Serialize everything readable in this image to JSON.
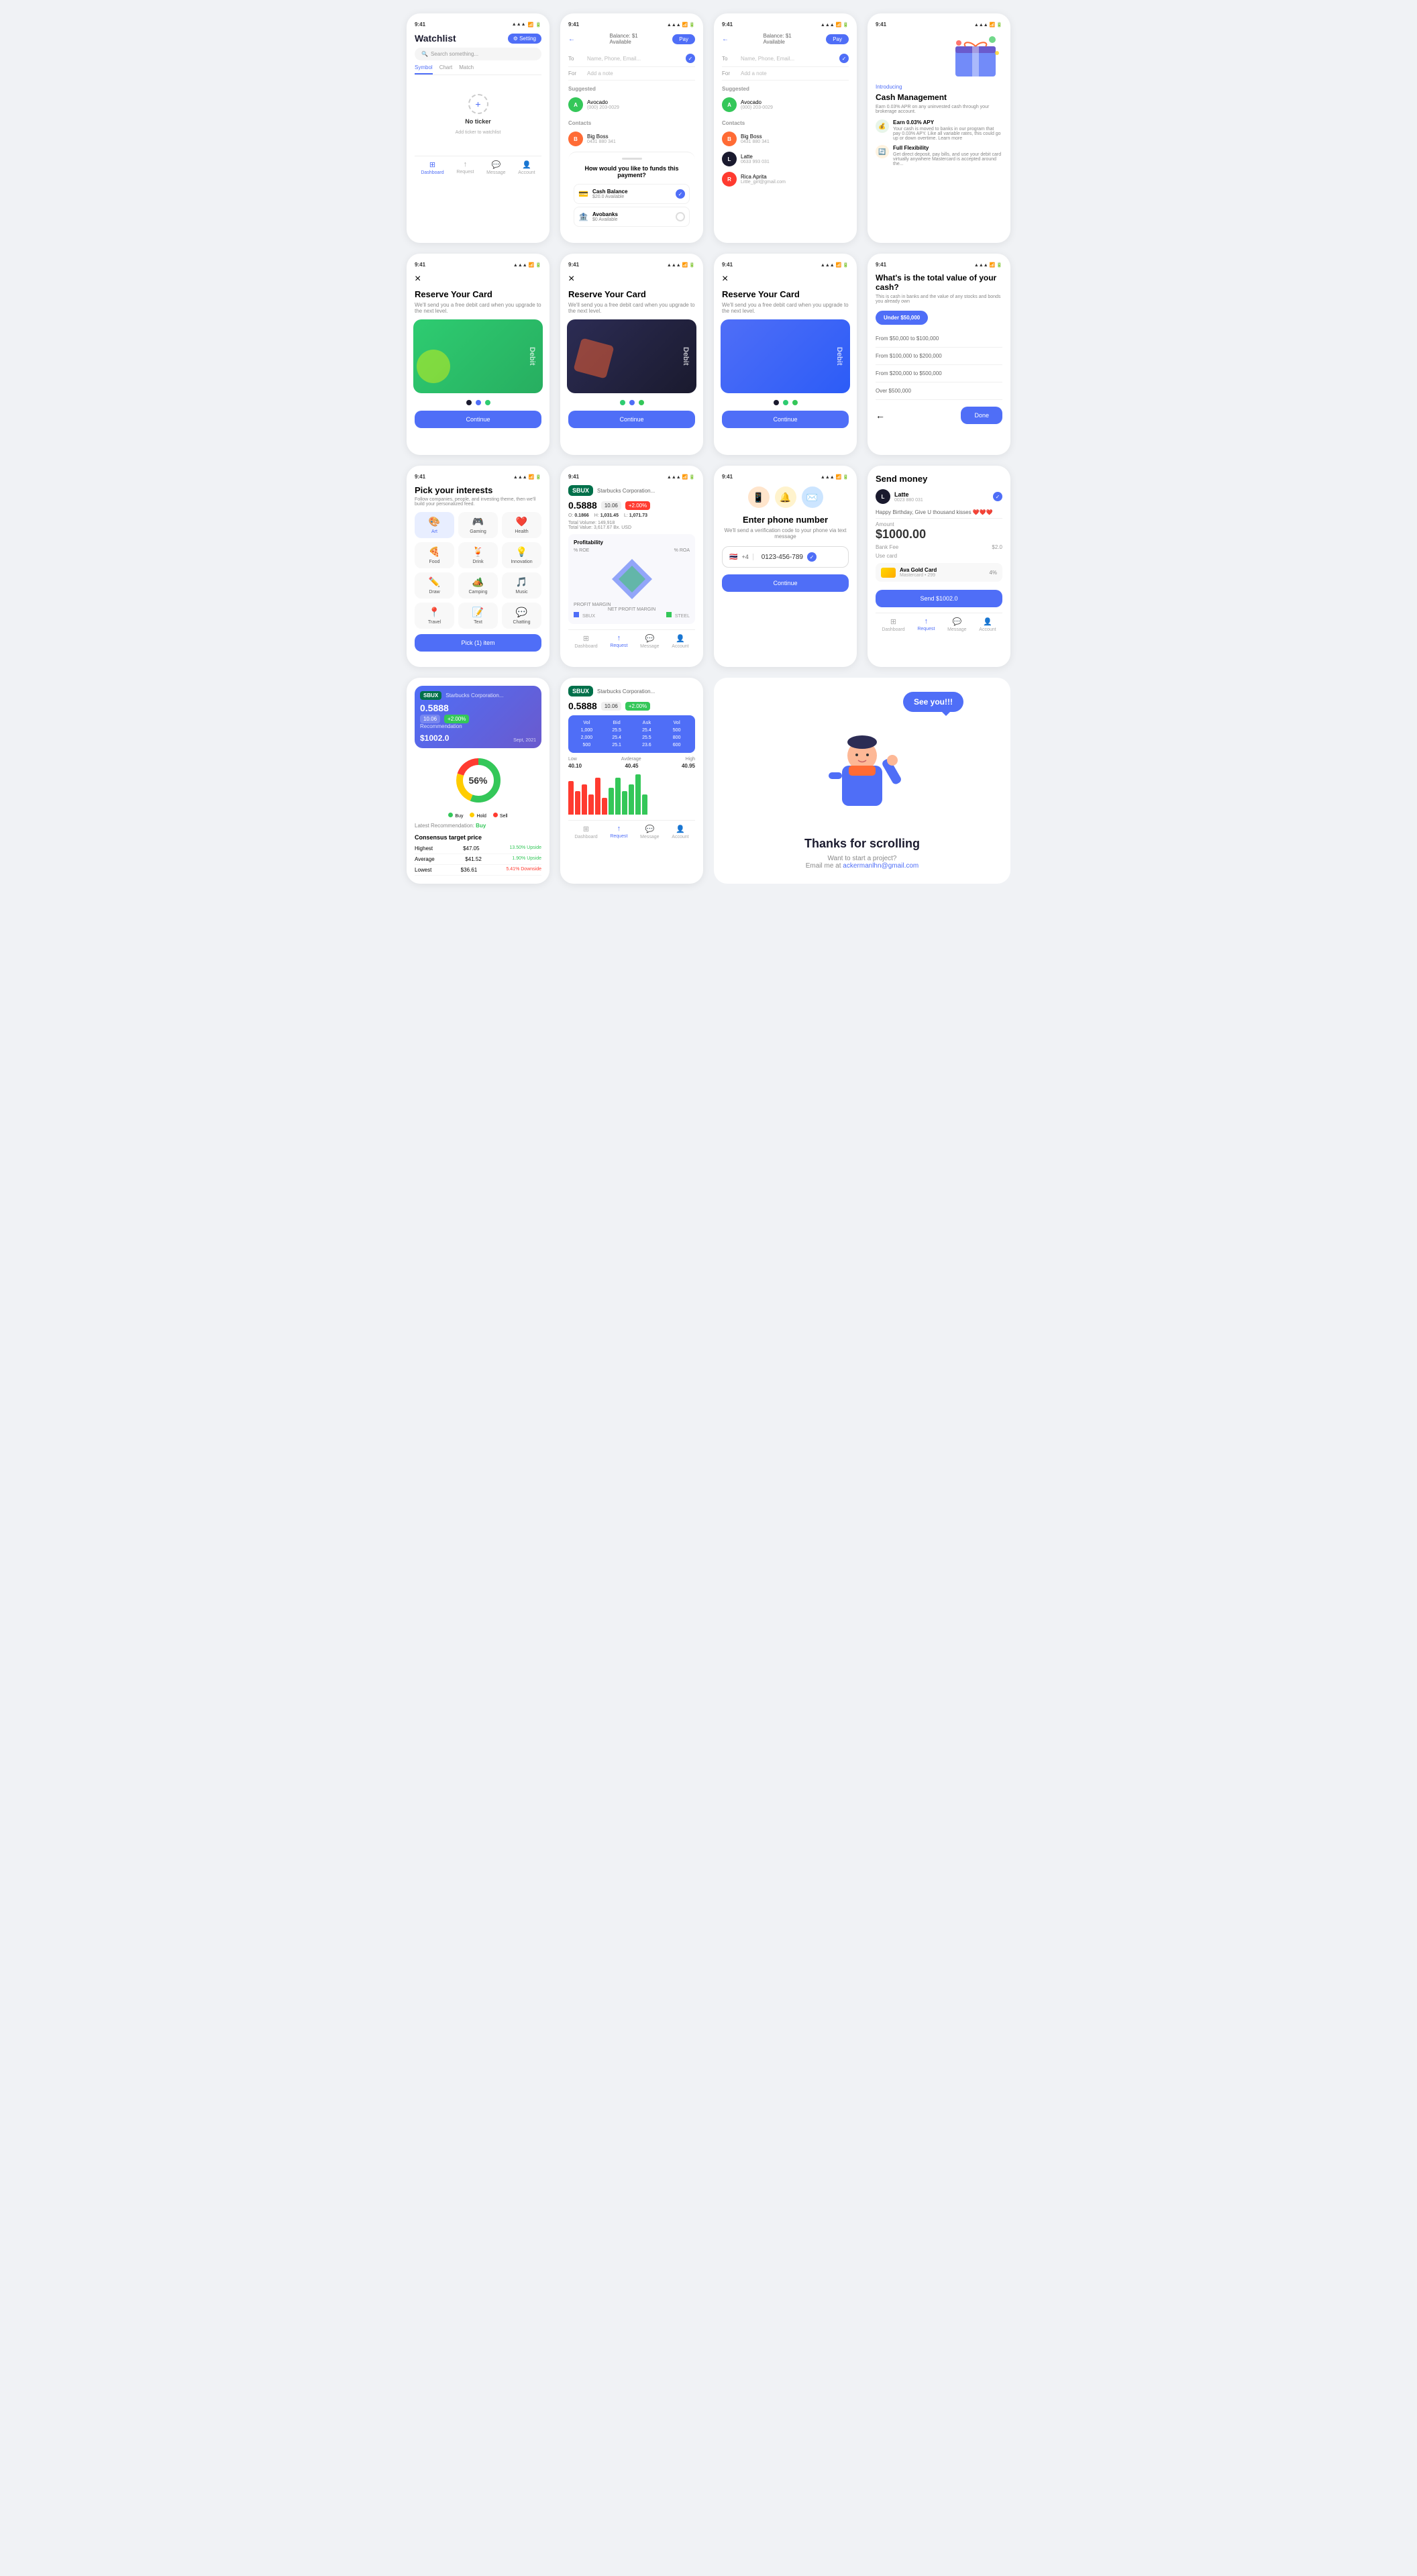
{
  "screens": {
    "watchlist": {
      "time": "9:41",
      "title": "Watchlist",
      "setting_btn": "⚙ Setting",
      "search_placeholder": "Search something...",
      "tabs": [
        "Symbol",
        "Chart",
        "Match"
      ],
      "active_tab": "Symbol",
      "no_ticker": "No ticker",
      "no_ticker_sub": "Add ticker to watchlist",
      "nav": [
        "Dashboard",
        "Request",
        "Message",
        "Account"
      ]
    },
    "payment1": {
      "time": "9:41",
      "balance": "Balance: $1",
      "available": "Available",
      "pay_btn": "Pay",
      "to_label": "To",
      "to_placeholder": "Name, Phone, Email...",
      "for_label": "For",
      "for_placeholder": "Add a note",
      "suggested": "Suggested",
      "contacts": "Contacts",
      "avocado_name": "Avocado",
      "avocado_phone": "(000) 203-0029",
      "bigboss_name": "Big Boss",
      "bigboss_phone": "0431 880 341",
      "funding_title": "How would you like to funds this payment?",
      "cash_balance": "Cash Balance",
      "cash_available": "$20.0 Available",
      "avobanks": "Avobanks",
      "avo_available": "$0 Available"
    },
    "payment2": {
      "time": "9:41",
      "balance": "Balance: $1",
      "available": "Available",
      "pay_btn": "Pay",
      "to_label": "To",
      "to_placeholder": "Name, Phone, Email...",
      "for_label": "For",
      "for_placeholder": "Add a note",
      "suggested": "Suggested",
      "contacts": "Contacts",
      "avocado_name": "Avocado",
      "avocado_phone": "(000) 203-0029",
      "bigboss_name": "Big Boss",
      "bigboss_phone": "0431 880 341",
      "latte_name": "Latte",
      "latte_phone": "0633 993 031",
      "rica_name": "Rica Aprita",
      "rica_email": "Little_girl@gmail.com"
    },
    "cash_mgmt": {
      "time": "9:41",
      "introducing": "Introducing",
      "title": "Cash Management",
      "subtitle": "Earn 0.03% APR on any uninvested cash through your brokerage account.",
      "feature1_title": "Earn 0.03% APY",
      "feature1_desc": "Your cash is moved to banks in our program that pay 0.03% APY. Like all variable rates, this could go up or down overtime. Learn more",
      "feature2_title": "Full Flexibility",
      "feature2_desc": "Get direct deposit, pay bills, and use your debit card virtually anywhere Mastercard is accepted around the..."
    },
    "reserve_green": {
      "time": "9:41",
      "close_icon": "×",
      "title": "Reserve Your Card",
      "subtitle": "We'll send you a free debit card when you upgrade to the next level.",
      "card_label": "Debit",
      "card_color": "green",
      "continue_btn": "Continue"
    },
    "reserve_dark": {
      "time": "9:41",
      "close_icon": "×",
      "title": "Reserve Your Card",
      "subtitle": "We'll send you a free debit card when you upgrade to the next level.",
      "card_label": "Debit",
      "card_color": "dark",
      "continue_btn": "Continue"
    },
    "reserve_blue": {
      "time": "9:41",
      "close_icon": "×",
      "title": "Reserve Your Card",
      "subtitle": "We'll send you a free debit card when you upgrade to the next level.",
      "card_label": "Debit",
      "card_color": "blue",
      "continue_btn": "Continue"
    },
    "cash_value": {
      "time": "9:41",
      "title": "What's is the total value of your cash?",
      "subtitle": "This is cash in banks and the value of any stocks and bonds you already own",
      "selected": "Under $50,000",
      "options": [
        "From $50,000 to $100,000",
        "From $100,000 to $200,000",
        "From $200,000 to $500,000",
        "Over $500,000"
      ],
      "back_icon": "←",
      "done_btn": "Done"
    },
    "interests": {
      "time": "9:41",
      "title": "Pick your interests",
      "subtitle": "Follow companies, people, and investing theme, then we'll build your personalized feed.",
      "items": [
        {
          "emoji": "🎨",
          "label": "Art",
          "active": true
        },
        {
          "emoji": "🎮",
          "label": "Gaming",
          "active": false
        },
        {
          "emoji": "❤️",
          "label": "Health",
          "active": false
        },
        {
          "emoji": "🍕",
          "label": "Food",
          "active": false
        },
        {
          "emoji": "🍹",
          "label": "Drink",
          "active": false
        },
        {
          "emoji": "💡",
          "label": "Innovation",
          "active": false
        },
        {
          "emoji": "✏️",
          "label": "Draw",
          "active": false
        },
        {
          "emoji": "🏕️",
          "label": "Camping",
          "active": false
        },
        {
          "emoji": "🎵",
          "label": "Music",
          "active": false
        },
        {
          "emoji": "📍",
          "label": "Travel",
          "active": false
        },
        {
          "emoji": "📝",
          "label": "Text",
          "active": false
        },
        {
          "emoji": "💬",
          "label": "Chatting",
          "active": false
        }
      ],
      "pick_btn": "Pick (1) item"
    },
    "sbux_chart": {
      "time": "9:41",
      "logo": "SBUX",
      "company": "Starbucks Corporation...",
      "price": "0.5888",
      "tag": "10.06",
      "change": "+2.00%",
      "change_up": false,
      "open": "0.1866",
      "high": "1,031.45",
      "low": "1,071.73",
      "total_volume": "Total Volume: 149,918",
      "total_value": "Total Value: 3,617.67 Bx. USD",
      "profitability": "Profitability",
      "pct_roe": "% ROE",
      "pct_roa": "% ROA",
      "profit_margin": "PROFIT MARGIN",
      "net_profit": "NET PROFIT MARGIN",
      "legend_sbux": "SBUX",
      "legend_steel": "STEEL",
      "nav": [
        "Dashboard",
        "Request",
        "Message",
        "Account"
      ]
    },
    "phone_number": {
      "time": "9:41",
      "title": "Enter phone number",
      "subtitle": "We'll send a verification code to your phone via text message",
      "flag": "🇹🇭",
      "code": "+4",
      "number": "0123-456-789",
      "continue_btn": "Continue"
    },
    "send_money": {
      "title": "Send money",
      "recipient": "Latte",
      "recipient_phone": "0023 880 031",
      "message": "Happy Birthday, Give U thousand kisses ❤️❤️❤️",
      "amount_label": "Amount",
      "amount": "$1000.00",
      "bank_fee_label": "Bank Fee",
      "bank_fee": "$2.0",
      "use_card_label": "Use card",
      "card_name": "Ava Gold Card",
      "card_type": "Mastercard • 299",
      "card_pct": "4%",
      "send_btn": "Send $1002.0",
      "nav": [
        "Dashboard",
        "Request",
        "Message",
        "Account"
      ]
    },
    "recommendation": {
      "logo": "SBUX",
      "company": "Starbucks Corporation...",
      "price": "0.5888",
      "tag": "10.06",
      "change": "+2.00%",
      "rec_label": "Recommendation",
      "rec_val": "$1002.0",
      "rec_symbol": "↗",
      "rec_date": "Sept, 2021",
      "donut_pct": "56%",
      "buy_pct": 56,
      "hold_pct": 24,
      "sell_pct": 20,
      "latest_label": "Latest Recommendation:",
      "latest_val": "Buy",
      "consensus_title": "Consensus target price",
      "rows": [
        {
          "label": "Highest",
          "price": "$47.05",
          "change": "13.50% Upside"
        },
        {
          "label": "Average",
          "price": "$41.52",
          "change": "1.90% Upside"
        },
        {
          "label": "Lowest",
          "price": "$36.61",
          "change": "5.41% Downside"
        }
      ]
    },
    "sbux_table": {
      "logo": "SBUX",
      "company": "Starbucks Corporation...",
      "price": "0.5888",
      "tag": "10.06",
      "change": "+2.00%",
      "table_headers": [
        "Vol",
        "Bid",
        "Ask",
        "Vol"
      ],
      "table_rows": [
        [
          "1,000",
          "25.5",
          "25.4",
          "500"
        ],
        [
          "2,000",
          "25.4",
          "25.5",
          "800"
        ],
        [
          "500",
          "25.1",
          "23.6",
          "600"
        ]
      ],
      "low": "Low",
      "low_val": "40.10",
      "average": "Avderage",
      "avg_val": "40.45",
      "high": "High",
      "high_val": "40.95",
      "nav": [
        "Dashboard",
        "Request",
        "Message",
        "Account"
      ]
    },
    "thanks": {
      "speech_bubble": "See you!!!",
      "title": "Thanks for scrolling",
      "subtitle": "Want to start a project?",
      "email_pre": "Email me at",
      "email": "ackermanlhn@gmail.com"
    }
  }
}
